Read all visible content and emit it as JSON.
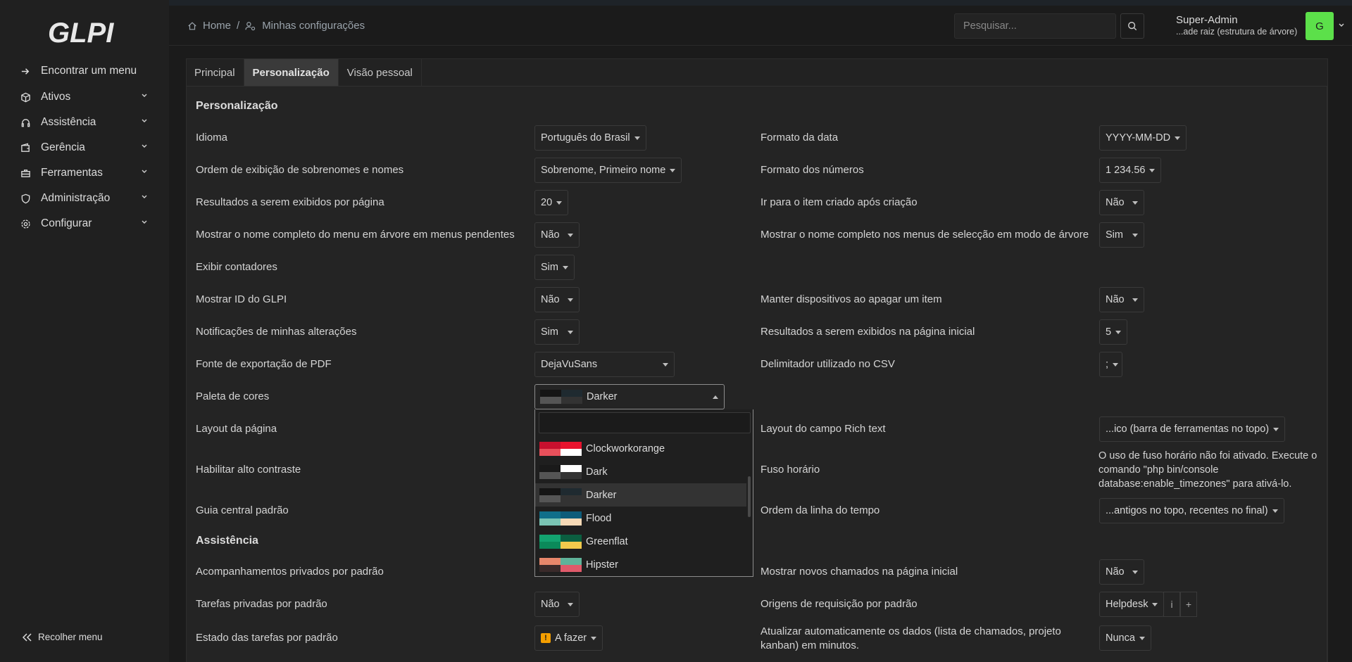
{
  "app": {
    "logo_text": "GLPI"
  },
  "sidebar": {
    "find_menu": "Encontrar um menu",
    "items": [
      {
        "label": "Ativos",
        "icon": "cube-icon"
      },
      {
        "label": "Assistência",
        "icon": "headset-icon"
      },
      {
        "label": "Gerência",
        "icon": "wallet-icon"
      },
      {
        "label": "Ferramentas",
        "icon": "briefcase-icon"
      },
      {
        "label": "Administração",
        "icon": "shield-icon"
      },
      {
        "label": "Configurar",
        "icon": "gear-icon"
      }
    ],
    "collapse": "Recolher menu"
  },
  "header": {
    "breadcrumb_home": "Home",
    "breadcrumb_sep": "/",
    "breadcrumb_current": "Minhas configurações",
    "search_placeholder": "Pesquisar...",
    "user_name": "Super-Admin",
    "user_entity": "...ade raiz (estrutura de árvore)",
    "avatar_letter": "G"
  },
  "tabs": [
    "Principal",
    "Personalização",
    "Visão pessoal"
  ],
  "sections": {
    "personalizacao": "Personalização",
    "assistencia": "Assistência"
  },
  "fields": {
    "idioma": {
      "label": "Idioma",
      "value": "Português do Brasil"
    },
    "formato_data": {
      "label": "Formato da data",
      "value": "YYYY-MM-DD"
    },
    "ordem_nomes": {
      "label": "Ordem de exibição de sobrenomes e nomes",
      "value": "Sobrenome, Primeiro nome"
    },
    "formato_numeros": {
      "label": "Formato dos números",
      "value": "1 234.56"
    },
    "resultados_pagina": {
      "label": "Resultados a serem exibidos por página",
      "value": "20"
    },
    "ir_item": {
      "label": "Ir para o item criado após criação",
      "value": "Não"
    },
    "nome_menu": {
      "label": "Mostrar o nome completo do menu em árvore em menus pendentes",
      "value": "Não"
    },
    "nome_selecao": {
      "label": "Mostrar o nome completo nos menus de selecção em modo de árvore",
      "value": "Sim"
    },
    "contadores": {
      "label": "Exibir contadores",
      "value": "Sim"
    },
    "mostrar_id": {
      "label": "Mostrar ID do GLPI",
      "value": "Não"
    },
    "manter_disp": {
      "label": "Manter dispositivos ao apagar um item",
      "value": "Não"
    },
    "notificacoes": {
      "label": "Notificações de minhas alterações",
      "value": "Sim"
    },
    "resultados_inicial": {
      "label": "Resultados a serem exibidos na página inicial",
      "value": "5"
    },
    "fonte_pdf": {
      "label": "Fonte de exportação de PDF",
      "value": "DejaVuSans"
    },
    "delimitador": {
      "label": "Delimitador utilizado no CSV",
      "value": ";"
    },
    "paleta": {
      "label": "Paleta de cores",
      "value": "Darker"
    },
    "layout_pagina": {
      "label": "Layout da página"
    },
    "layout_rich": {
      "label": "Layout do campo Rich text",
      "value": "...ico (barra de ferramentas no topo)"
    },
    "alto_contraste": {
      "label": "Habilitar alto contraste"
    },
    "fuso": {
      "label": "Fuso horário",
      "note": "O uso de fuso horário não foi ativado. Execute o comando \"php bin/console database:enable_timezones\" para ativá-lo."
    },
    "guia_central": {
      "label": "Guia central padrão"
    },
    "ordem_linha": {
      "label": "Ordem da linha do tempo",
      "value": "...antigos no topo, recentes no final)"
    },
    "acomp_privados": {
      "label": "Acompanhamentos privados por padrão"
    },
    "novos_chamados": {
      "label": "Mostrar novos chamados na página inicial",
      "value": "Não"
    },
    "tarefas_privadas": {
      "label": "Tarefas privadas por padrão",
      "value": "Não"
    },
    "origens": {
      "label": "Origens de requisição por padrão",
      "value": "Helpdesk",
      "info": "i",
      "add": "+"
    },
    "estado_tarefas": {
      "label": "Estado das tarefas por padrão",
      "value": "A fazer",
      "badge": "!"
    },
    "atualizar": {
      "label": "Atualizar automaticamente os dados (lista de chamados, projeto kanban) em minutos.",
      "value": "Nunca"
    }
  },
  "palette_dropdown": {
    "options": [
      {
        "name": "Clockworkorange",
        "colors": [
          "#c8102e",
          "#e8132e",
          "#e8505b",
          "#ffffff"
        ]
      },
      {
        "name": "Dark",
        "colors": [
          "#1a1a1a",
          "#ffffff",
          "#555555",
          "#333333"
        ]
      },
      {
        "name": "Darker",
        "colors": [
          "#151515",
          "#1f2a30",
          "#555555",
          "#333333"
        ],
        "highlighted": true
      },
      {
        "name": "Flood",
        "colors": [
          "#106f8a",
          "#0e5c7a",
          "#7ac4b4",
          "#f6d9b6"
        ]
      },
      {
        "name": "Greenflat",
        "colors": [
          "#13a370",
          "#0b5e40",
          "#0b8a5a",
          "#f2c94c"
        ]
      },
      {
        "name": "Hipster",
        "colors": [
          "#e8876b",
          "#5fb39a",
          "#3a2a2a",
          "#e05a6a"
        ]
      }
    ]
  },
  "colors": {
    "accent_avatar": "#5ce04a",
    "background": "#1b1b1b",
    "sidebar": "#202020"
  }
}
